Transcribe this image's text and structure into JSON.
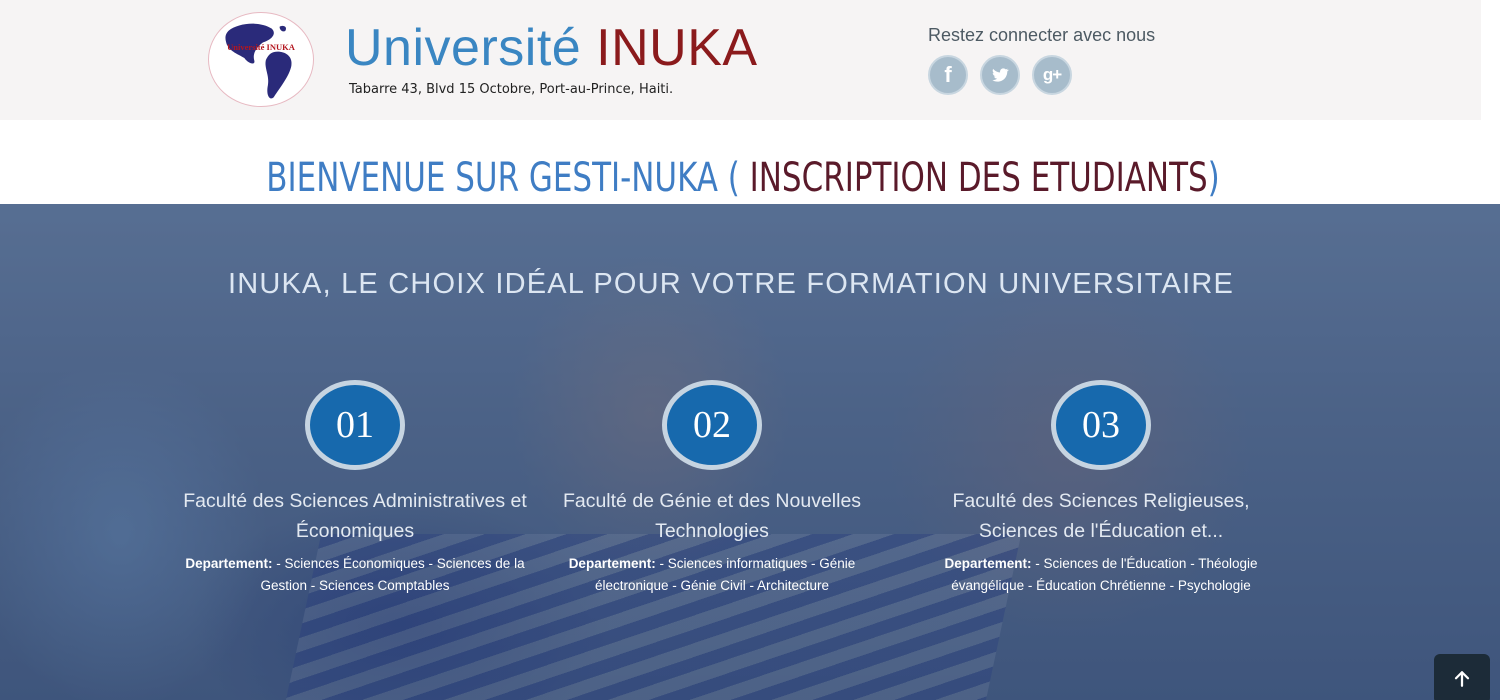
{
  "header": {
    "logo_text": "Université INUKA",
    "title_part1": "Université",
    "title_part2": "INUKA",
    "address": "Tabarre 43, Blvd 15 Octobre, Port-au-Prince, Haiti.",
    "social_label": "Restez connecter avec nous",
    "social": [
      {
        "name": "facebook",
        "icon": "facebook-icon",
        "glyph": "f"
      },
      {
        "name": "twitter",
        "icon": "twitter-icon"
      },
      {
        "name": "google-plus",
        "icon": "google-plus-icon",
        "glyph": "g+"
      }
    ]
  },
  "welcome": {
    "part1": "BIENVENUE SUR GESTI-NUKA (",
    "part2": "INSCRIPTION DES ETUDIANTS",
    "part3": ")"
  },
  "hero": {
    "title": "INUKA, LE CHOIX IDÉAL POUR VOTRE FORMATION UNIVERSITAIRE",
    "faculties": [
      {
        "number": "01",
        "name": "Faculté des Sciences Administratives et Économiques",
        "dept_label": "Departement:",
        "dept_text": " - Sciences Économiques - Sciences de la Gestion - Sciences Comptables"
      },
      {
        "number": "02",
        "name": "Faculté de Génie et des Nouvelles Technologies",
        "dept_label": "Departement:",
        "dept_text": " - Sciences informatiques - Génie électronique - Génie Civil - Architecture"
      },
      {
        "number": "03",
        "name": "Faculté des Sciences Religieuses, Sciences de l'Éducation et...",
        "dept_label": "Departement:",
        "dept_text": " - Sciences de l'Éducation - Théologie évangélique - Éducation Chrétienne - Psychologie"
      }
    ]
  },
  "back_to_top": {
    "icon": "arrow-up-icon"
  },
  "colors": {
    "title_blue": "#3a86c2",
    "title_red": "#8b1a1c",
    "welcome_blue": "#3f7dc4",
    "welcome_maroon": "#5a1a2a",
    "badge_blue": "#1769ad"
  }
}
